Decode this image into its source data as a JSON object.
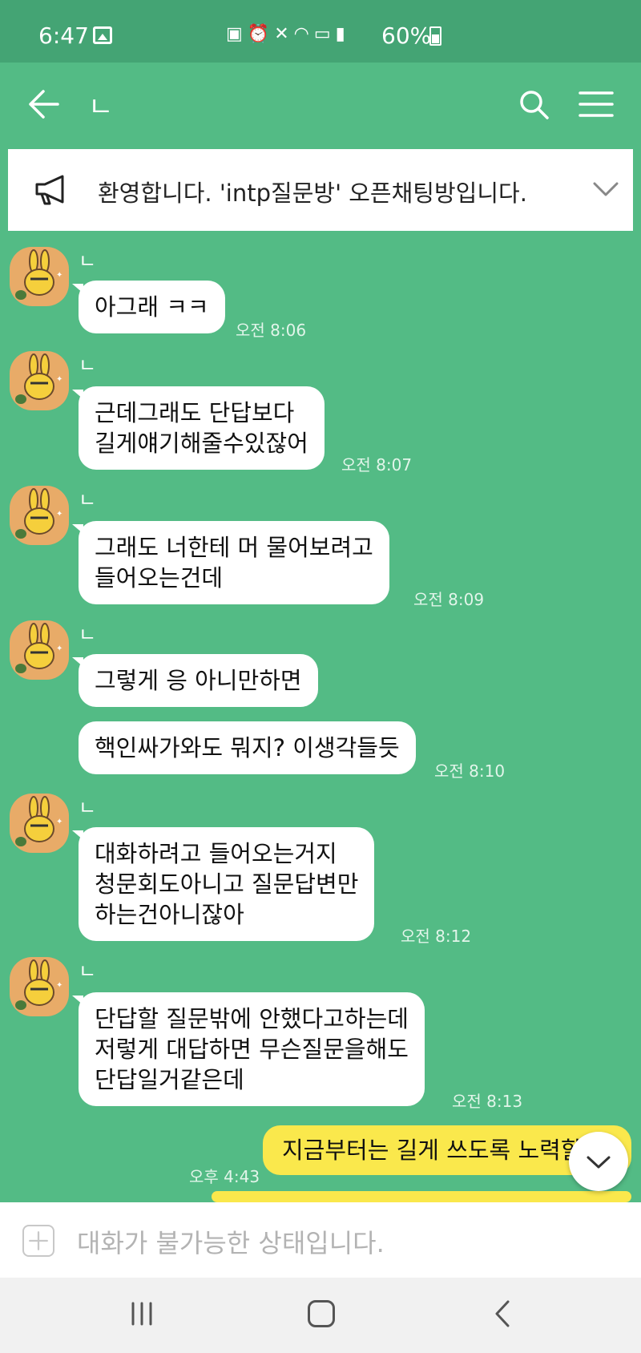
{
  "status_bar": {
    "time": "6:47",
    "icons": [
      "gallery-icon",
      "battery-saver-icon",
      "alarm-icon",
      "mute-icon",
      "wifi-icon",
      "hd-icon",
      "signal-icon"
    ],
    "battery": "60%"
  },
  "header": {
    "title": "ㄴ",
    "icons": [
      "back-arrow-icon",
      "search-icon",
      "menu-icon"
    ]
  },
  "notice": {
    "text": "환영합니다. 'intp질문방' 오픈채팅방입니다."
  },
  "messages": [
    {
      "sender": "ㄴ",
      "bubbles": [
        "아그래 ㅋㅋ"
      ],
      "time": "오전 8:06"
    },
    {
      "sender": "ㄴ",
      "bubbles": [
        "근데그래도 단답보다\n길게얘기해줄수있잖어"
      ],
      "time": "오전 8:07"
    },
    {
      "sender": "ㄴ",
      "bubbles": [
        "그래도 너한테 머 물어보려고\n들어오는건데"
      ],
      "time": "오전 8:09"
    },
    {
      "sender": "ㄴ",
      "bubbles": [
        "그렇게 응 아니만하면",
        "핵인싸가와도 뭐지? 이생각들듯"
      ],
      "time": "오전 8:10"
    },
    {
      "sender": "ㄴ",
      "bubbles": [
        "대화하려고 들어오는거지\n청문회도아니고 질문답변만\n하는건아니잖아"
      ],
      "time": "오전 8:12"
    },
    {
      "sender": "ㄴ",
      "bubbles": [
        "단답할 질문밖에 안했다고하는데\n저렇게 대답하면 무슨질문을해도\n단답일거같은데"
      ],
      "time": "오전 8:13"
    }
  ],
  "my_message": {
    "text": "지금부터는 길게 쓰도록 노력할게",
    "time": "오후 4:43"
  },
  "input": {
    "placeholder": "대화가 불가능한 상태입니다."
  },
  "colors": {
    "chat_bg": "#53bb85",
    "status_bg": "#44a474",
    "my_bubble": "#fae84c",
    "other_bubble": "#ffffff"
  }
}
